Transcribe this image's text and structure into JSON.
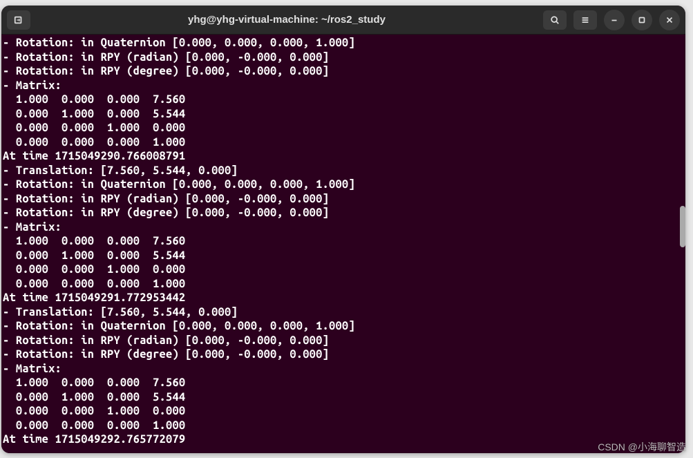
{
  "titlebar": {
    "title": "yhg@yhg-virtual-machine: ~/ros2_study"
  },
  "blocks": [
    {
      "at_time": null,
      "translation": null,
      "quat": "[0.000, 0.000, 0.000, 1.000]",
      "rpy_rad": "[0.000, -0.000, 0.000]",
      "rpy_deg": "[0.000, -0.000, 0.000]",
      "matrix": [
        "  1.000  0.000  0.000  7.560",
        "  0.000  1.000  0.000  5.544",
        "  0.000  0.000  1.000  0.000",
        "  0.000  0.000  0.000  1.000"
      ]
    },
    {
      "at_time": "1715049290.766008791",
      "translation": "[7.560, 5.544, 0.000]",
      "quat": "[0.000, 0.000, 0.000, 1.000]",
      "rpy_rad": "[0.000, -0.000, 0.000]",
      "rpy_deg": "[0.000, -0.000, 0.000]",
      "matrix": [
        "  1.000  0.000  0.000  7.560",
        "  0.000  1.000  0.000  5.544",
        "  0.000  0.000  1.000  0.000",
        "  0.000  0.000  0.000  1.000"
      ]
    },
    {
      "at_time": "1715049291.772953442",
      "translation": "[7.560, 5.544, 0.000]",
      "quat": "[0.000, 0.000, 0.000, 1.000]",
      "rpy_rad": "[0.000, -0.000, 0.000]",
      "rpy_deg": "[0.000, -0.000, 0.000]",
      "matrix": [
        "  1.000  0.000  0.000  7.560",
        "  0.000  1.000  0.000  5.544",
        "  0.000  0.000  1.000  0.000",
        "  0.000  0.000  0.000  1.000"
      ]
    }
  ],
  "trailing_at_time": "1715049292.765772079",
  "labels": {
    "rotation_quat": "- Rotation: in Quaternion ",
    "rotation_rpy_rad": "- Rotation: in RPY (radian) ",
    "rotation_rpy_deg": "- Rotation: in RPY (degree) ",
    "translation": "- Translation: ",
    "matrix": "- Matrix:",
    "at_time": "At time "
  },
  "watermark": "CSDN @小海聊智造"
}
